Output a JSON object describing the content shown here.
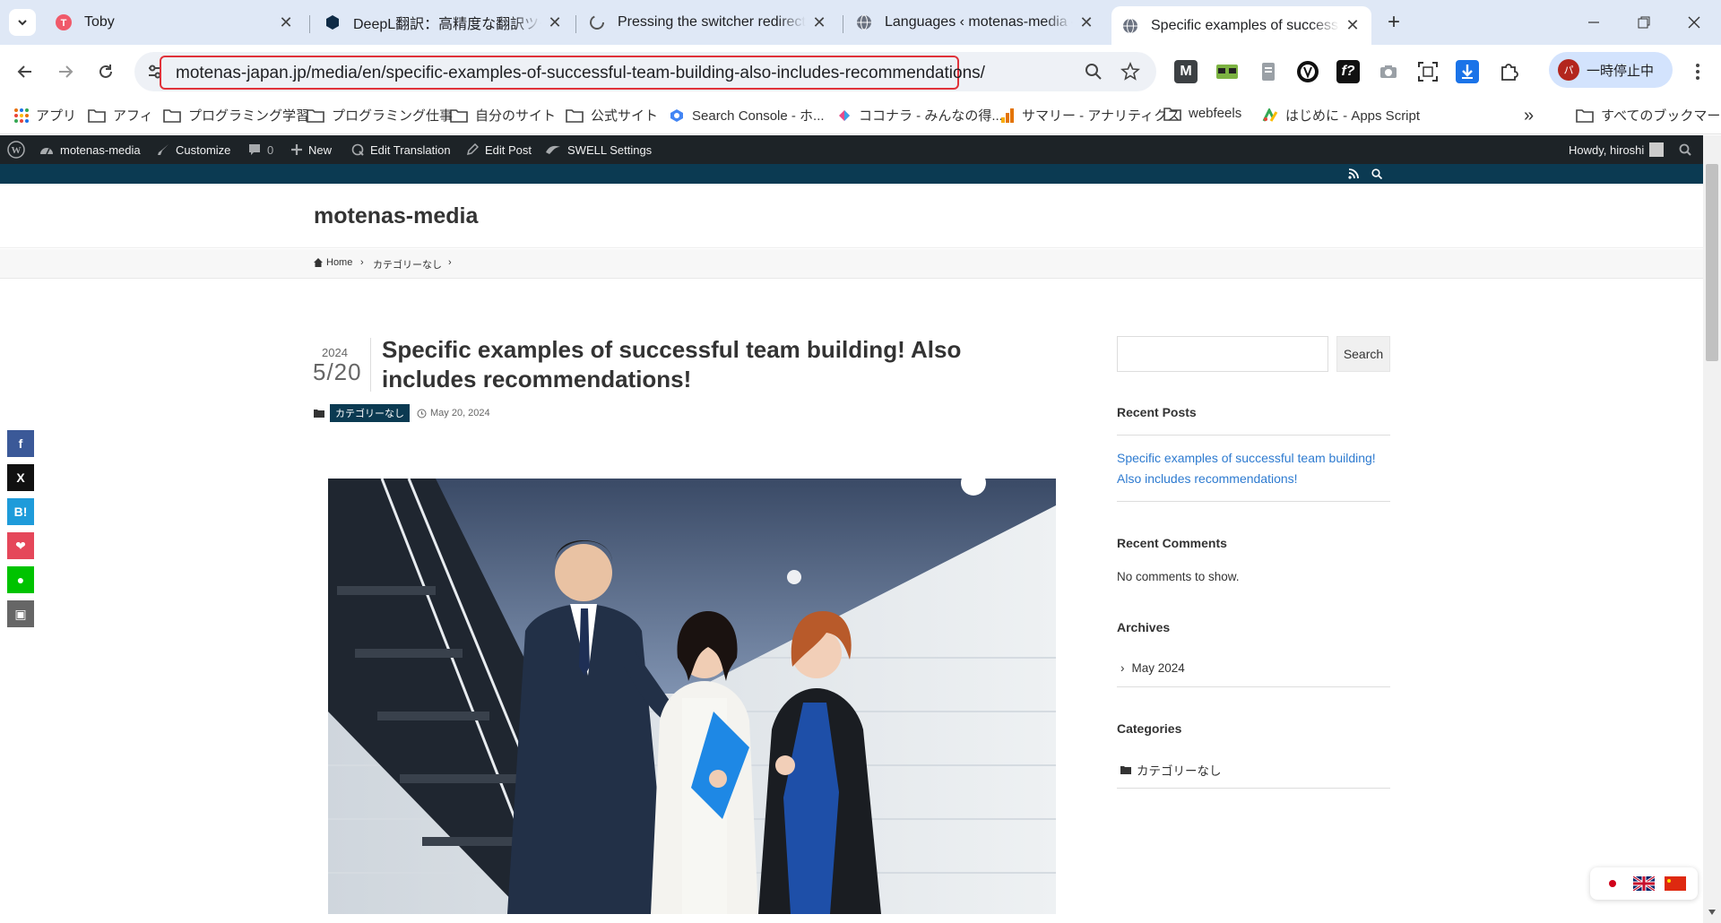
{
  "browser": {
    "tabs": [
      {
        "title": "Toby",
        "active": false
      },
      {
        "title": "DeepL翻訳：高精度な翻訳ツール",
        "active": false
      },
      {
        "title": "Pressing the switcher redirects",
        "active": false
      },
      {
        "title": "Languages ‹ motenas-media —",
        "active": false
      },
      {
        "title": "Specific examples of successful",
        "active": true
      }
    ],
    "url": "motenas-japan.jp/media/en/specific-examples-of-successful-team-building-also-includes-recommendations/",
    "profile_label": "一時停止中",
    "profile_initial": "パ",
    "bookmarks": [
      "アプリ",
      "アフィ",
      "プログラミング学習",
      "プログラミング仕事",
      "自分のサイト",
      "公式サイト",
      "Search Console - ホ...",
      "ココナラ - みんなの得...",
      "サマリー - アナリティクス",
      "webfeels",
      "はじめに - Apps Script"
    ],
    "all_bookmarks": "すべてのブックマーク",
    "colors": {
      "tabbar": "#dfe8f6",
      "highlight": "#e0323a",
      "profile": "#d3e3fd"
    }
  },
  "adminbar": {
    "items": [
      "motenas-media",
      "Customize",
      "0",
      "New",
      "Edit Translation",
      "Edit Post",
      "SWELL Settings"
    ],
    "howdy": "Howdy, hiroshi"
  },
  "site": {
    "title": "motenas-media",
    "breadcrumb": {
      "home": "Home",
      "category": "カテゴリーなし"
    },
    "accent": "#0b3a52"
  },
  "post": {
    "year": "2024",
    "monthday": "5/20",
    "title": "Specific examples of successful team building! Also includes recommendations!",
    "category": "カテゴリーなし",
    "date": "May 20, 2024"
  },
  "sidebar": {
    "search_button": "Search",
    "recent_posts_title": "Recent Posts",
    "recent_post": "Specific examples of successful team building! Also includes recommendations!",
    "recent_comments_title": "Recent Comments",
    "no_comments": "No comments to show.",
    "archives_title": "Archives",
    "archive_item": "May 2024",
    "categories_title": "Categories",
    "category_item": "カテゴリーなし"
  },
  "share": [
    {
      "icon": "facebook-icon",
      "glyph": "f",
      "color": "#3b5998"
    },
    {
      "icon": "x-icon",
      "glyph": "X",
      "color": "#111111"
    },
    {
      "icon": "hatena-icon",
      "glyph": "B!",
      "color": "#1e9bda"
    },
    {
      "icon": "pocket-icon",
      "glyph": "❤",
      "color": "#e5475a"
    },
    {
      "icon": "line-icon",
      "glyph": "●",
      "color": "#00c300"
    },
    {
      "icon": "copy-icon",
      "glyph": "▣",
      "color": "#666666"
    }
  ]
}
